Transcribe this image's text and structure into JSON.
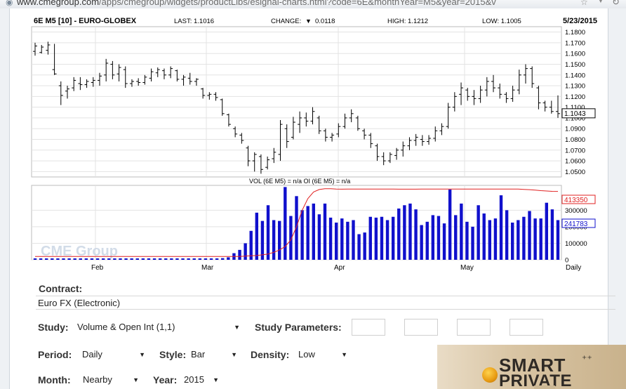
{
  "browser": {
    "url_domain": "www.cmegroup.com",
    "url_path": "/apps/cmegroup/widgets/productLibs/esignal-charts.html?code=6E&monthYear=M5&year=2015&v"
  },
  "chart": {
    "symbol_title": "6E M5 [10] - EURO-GLOBEX",
    "last": "LAST: 1.1016",
    "change_label": "CHANGE:",
    "change_arrow": "▼",
    "change_value": "0.0118",
    "high": "HIGH: 1.1212",
    "low": "LOW: 1.1005",
    "date": "5/23/2015",
    "price_axis": [
      "1.1800",
      "1.1700",
      "1.1600",
      "1.1500",
      "1.1400",
      "1.1300",
      "1.1200",
      "1.1100",
      "1.1000",
      "1.0900",
      "1.0800",
      "1.0700",
      "1.0600",
      "1.0500"
    ],
    "price_axis_values": [
      1.18,
      1.17,
      1.16,
      1.15,
      1.14,
      1.13,
      1.12,
      1.11,
      1.1,
      1.09,
      1.08,
      1.07,
      1.06,
      1.05
    ],
    "price_readout": "1.1043",
    "price_readout_value": 1.1043,
    "volume_title": "VOL (6E M5) = n/a OI (6E M5) = n/a",
    "volume_axis": [
      "300000",
      "200000",
      "100000",
      "0"
    ],
    "volume_axis_values": [
      300000,
      200000,
      100000,
      0
    ],
    "oi_readout": "413350",
    "oi_readout_value": 413350,
    "vol_readout": "241783",
    "vol_readout_value": 241783,
    "x_labels": [
      "Feb",
      "Mar",
      "Apr",
      "May",
      "Daily"
    ],
    "watermark": "CME Group",
    "colors": {
      "bars": "#1010cc",
      "oi_line": "#e02020",
      "oi_box": "#e02020",
      "vol_box": "#1010cc",
      "price": "#000000"
    }
  },
  "chart_data": {
    "type": "bar",
    "title": "6E M5 [10] - EURO-GLOBEX",
    "price_range": [
      1.045,
      1.185
    ],
    "volume_range": [
      0,
      450000
    ],
    "price_ohlc_bars": [
      {
        "h": 1.17,
        "l": 1.158,
        "o": 1.162,
        "c": 1.167
      },
      {
        "h": 1.168,
        "l": 1.16,
        "o": 1.161,
        "c": 1.166
      },
      {
        "h": 1.171,
        "l": 1.159,
        "o": 1.163,
        "c": 1.168
      },
      {
        "h": 1.169,
        "l": 1.14,
        "o": 1.145,
        "c": 1.141
      },
      {
        "h": 1.134,
        "l": 1.112,
        "o": 1.13,
        "c": 1.121
      },
      {
        "h": 1.13,
        "l": 1.118,
        "o": 1.125,
        "c": 1.127
      },
      {
        "h": 1.138,
        "l": 1.125,
        "o": 1.128,
        "c": 1.135
      },
      {
        "h": 1.138,
        "l": 1.126,
        "o": 1.132,
        "c": 1.131
      },
      {
        "h": 1.136,
        "l": 1.128,
        "o": 1.131,
        "c": 1.134
      },
      {
        "h": 1.138,
        "l": 1.129,
        "o": 1.133,
        "c": 1.135
      },
      {
        "h": 1.142,
        "l": 1.13,
        "o": 1.135,
        "c": 1.139
      },
      {
        "h": 1.155,
        "l": 1.134,
        "o": 1.14,
        "c": 1.151
      },
      {
        "h": 1.153,
        "l": 1.136,
        "o": 1.15,
        "c": 1.14
      },
      {
        "h": 1.15,
        "l": 1.134,
        "o": 1.141,
        "c": 1.147
      },
      {
        "h": 1.148,
        "l": 1.128,
        "o": 1.145,
        "c": 1.132
      },
      {
        "h": 1.136,
        "l": 1.129,
        "o": 1.132,
        "c": 1.134
      },
      {
        "h": 1.137,
        "l": 1.13,
        "o": 1.134,
        "c": 1.133
      },
      {
        "h": 1.14,
        "l": 1.131,
        "o": 1.133,
        "c": 1.138
      },
      {
        "h": 1.146,
        "l": 1.134,
        "o": 1.137,
        "c": 1.143
      },
      {
        "h": 1.147,
        "l": 1.138,
        "o": 1.142,
        "c": 1.145
      },
      {
        "h": 1.146,
        "l": 1.136,
        "o": 1.144,
        "c": 1.14
      },
      {
        "h": 1.148,
        "l": 1.137,
        "o": 1.14,
        "c": 1.146
      },
      {
        "h": 1.145,
        "l": 1.134,
        "o": 1.144,
        "c": 1.136
      },
      {
        "h": 1.14,
        "l": 1.13,
        "o": 1.136,
        "c": 1.138
      },
      {
        "h": 1.142,
        "l": 1.131,
        "o": 1.137,
        "c": 1.134
      },
      {
        "h": 1.137,
        "l": 1.13,
        "o": 1.134,
        "c": 1.136
      },
      {
        "h": 1.128,
        "l": 1.118,
        "o": 1.127,
        "c": 1.121
      },
      {
        "h": 1.124,
        "l": 1.117,
        "o": 1.121,
        "c": 1.122
      },
      {
        "h": 1.124,
        "l": 1.116,
        "o": 1.122,
        "c": 1.119
      },
      {
        "h": 1.118,
        "l": 1.102,
        "o": 1.117,
        "c": 1.104
      },
      {
        "h": 1.104,
        "l": 1.092,
        "o": 1.103,
        "c": 1.094
      },
      {
        "h": 1.092,
        "l": 1.082,
        "o": 1.09,
        "c": 1.085
      },
      {
        "h": 1.086,
        "l": 1.076,
        "o": 1.084,
        "c": 1.079
      },
      {
        "h": 1.074,
        "l": 1.055,
        "o": 1.072,
        "c": 1.06
      },
      {
        "h": 1.068,
        "l": 1.05,
        "o": 1.06,
        "c": 1.066
      },
      {
        "h": 1.066,
        "l": 1.048,
        "o": 1.064,
        "c": 1.052
      },
      {
        "h": 1.064,
        "l": 1.052,
        "o": 1.054,
        "c": 1.061
      },
      {
        "h": 1.072,
        "l": 1.058,
        "o": 1.062,
        "c": 1.068
      },
      {
        "h": 1.098,
        "l": 1.06,
        "o": 1.066,
        "c": 1.094
      },
      {
        "h": 1.094,
        "l": 1.072,
        "o": 1.09,
        "c": 1.078
      },
      {
        "h": 1.101,
        "l": 1.08,
        "o": 1.082,
        "c": 1.096
      },
      {
        "h": 1.106,
        "l": 1.086,
        "o": 1.094,
        "c": 1.1
      },
      {
        "h": 1.105,
        "l": 1.092,
        "o": 1.1,
        "c": 1.097
      },
      {
        "h": 1.11,
        "l": 1.094,
        "o": 1.097,
        "c": 1.106
      },
      {
        "h": 1.102,
        "l": 1.085,
        "o": 1.1,
        "c": 1.088
      },
      {
        "h": 1.09,
        "l": 1.078,
        "o": 1.088,
        "c": 1.082
      },
      {
        "h": 1.086,
        "l": 1.078,
        "o": 1.082,
        "c": 1.084
      },
      {
        "h": 1.095,
        "l": 1.082,
        "o": 1.085,
        "c": 1.092
      },
      {
        "h": 1.104,
        "l": 1.09,
        "o": 1.092,
        "c": 1.1
      },
      {
        "h": 1.108,
        "l": 1.096,
        "o": 1.1,
        "c": 1.104
      },
      {
        "h": 1.102,
        "l": 1.088,
        "o": 1.1,
        "c": 1.09
      },
      {
        "h": 1.09,
        "l": 1.08,
        "o": 1.088,
        "c": 1.084
      },
      {
        "h": 1.086,
        "l": 1.072,
        "o": 1.084,
        "c": 1.076
      },
      {
        "h": 1.076,
        "l": 1.06,
        "o": 1.074,
        "c": 1.064
      },
      {
        "h": 1.068,
        "l": 1.056,
        "o": 1.064,
        "c": 1.06
      },
      {
        "h": 1.068,
        "l": 1.058,
        "o": 1.06,
        "c": 1.066
      },
      {
        "h": 1.072,
        "l": 1.061,
        "o": 1.065,
        "c": 1.07
      },
      {
        "h": 1.078,
        "l": 1.064,
        "o": 1.07,
        "c": 1.074
      },
      {
        "h": 1.082,
        "l": 1.07,
        "o": 1.074,
        "c": 1.079
      },
      {
        "h": 1.085,
        "l": 1.074,
        "o": 1.079,
        "c": 1.082
      },
      {
        "h": 1.084,
        "l": 1.074,
        "o": 1.08,
        "c": 1.078
      },
      {
        "h": 1.084,
        "l": 1.075,
        "o": 1.078,
        "c": 1.081
      },
      {
        "h": 1.092,
        "l": 1.078,
        "o": 1.081,
        "c": 1.088
      },
      {
        "h": 1.095,
        "l": 1.084,
        "o": 1.088,
        "c": 1.092
      },
      {
        "h": 1.114,
        "l": 1.09,
        "o": 1.092,
        "c": 1.11
      },
      {
        "h": 1.124,
        "l": 1.106,
        "o": 1.11,
        "c": 1.12
      },
      {
        "h": 1.133,
        "l": 1.112,
        "o": 1.122,
        "c": 1.128
      },
      {
        "h": 1.128,
        "l": 1.116,
        "o": 1.126,
        "c": 1.12
      },
      {
        "h": 1.126,
        "l": 1.112,
        "o": 1.12,
        "c": 1.118
      },
      {
        "h": 1.13,
        "l": 1.114,
        "o": 1.118,
        "c": 1.126
      },
      {
        "h": 1.138,
        "l": 1.12,
        "o": 1.126,
        "c": 1.134
      },
      {
        "h": 1.14,
        "l": 1.124,
        "o": 1.134,
        "c": 1.128
      },
      {
        "h": 1.132,
        "l": 1.118,
        "o": 1.128,
        "c": 1.122
      },
      {
        "h": 1.124,
        "l": 1.114,
        "o": 1.122,
        "c": 1.118
      },
      {
        "h": 1.13,
        "l": 1.115,
        "o": 1.118,
        "c": 1.126
      },
      {
        "h": 1.145,
        "l": 1.122,
        "o": 1.126,
        "c": 1.14
      },
      {
        "h": 1.15,
        "l": 1.132,
        "o": 1.14,
        "c": 1.146
      },
      {
        "h": 1.148,
        "l": 1.128,
        "o": 1.146,
        "c": 1.132
      },
      {
        "h": 1.13,
        "l": 1.108,
        "o": 1.128,
        "c": 1.114
      },
      {
        "h": 1.116,
        "l": 1.106,
        "o": 1.114,
        "c": 1.11
      },
      {
        "h": 1.116,
        "l": 1.104,
        "o": 1.11,
        "c": 1.106
      },
      {
        "h": 1.121,
        "l": 1.1,
        "o": 1.106,
        "c": 1.104
      }
    ],
    "volume_bars": [
      {
        "month_index": 0,
        "values": [
          5000,
          5000,
          5000,
          5000,
          5000,
          5000,
          5000,
          5000,
          5000,
          5000,
          5000,
          5000,
          5000,
          5000,
          5000,
          5000,
          5000,
          5000,
          5000,
          5000
        ]
      },
      {
        "month_index": 1,
        "values": [
          5000,
          5000,
          5000,
          5000,
          5000,
          6000,
          6000,
          6000,
          6000,
          6000,
          7000,
          7000,
          8000,
          10000,
          15000,
          40000,
          60000,
          100000,
          175000,
          280000
        ]
      }
    ],
    "volume_values": [
      5000,
      5000,
      5000,
      5000,
      5000,
      5000,
      5000,
      5000,
      5000,
      5000,
      5000,
      5000,
      5000,
      5000,
      5000,
      5000,
      5000,
      5000,
      5000,
      5000,
      5000,
      5000,
      5000,
      5000,
      5000,
      6000,
      6000,
      6000,
      6000,
      6000,
      7000,
      7000,
      8000,
      10000,
      15000,
      40000,
      60000,
      100000,
      175000,
      285000,
      235000,
      330000,
      240000,
      235000,
      440000,
      265000,
      385000,
      300000,
      325000,
      340000,
      275000,
      340000,
      255000,
      225000,
      250000,
      230000,
      240000,
      155000,
      165000,
      260000,
      255000,
      260000,
      240000,
      260000,
      310000,
      330000,
      340000,
      305000,
      210000,
      230000,
      270000,
      265000,
      220000,
      425000,
      270000,
      340000,
      230000,
      200000,
      330000,
      280000,
      240000,
      250000,
      390000,
      300000,
      225000,
      240000,
      260000,
      295000,
      250000,
      250000,
      345000,
      305000,
      240000
    ],
    "oi_values": [
      20000,
      20000,
      20000,
      20000,
      20000,
      20000,
      20000,
      20000,
      20000,
      20000,
      20000,
      20000,
      20000,
      20000,
      20000,
      20000,
      20000,
      20000,
      20000,
      20000,
      20000,
      20000,
      20000,
      20000,
      20000,
      20000,
      20000,
      20000,
      20000,
      20000,
      20000,
      20000,
      20000,
      20000,
      20000,
      20000,
      20000,
      22000,
      24000,
      26000,
      30000,
      35000,
      45000,
      60000,
      80000,
      120000,
      200000,
      300000,
      370000,
      410000,
      425000,
      430000,
      430000,
      428000,
      427000,
      428000,
      428000,
      428000,
      428000,
      428000,
      428000,
      428000,
      428000,
      428000,
      427000,
      427000,
      427000,
      427000,
      428000,
      428000,
      428000,
      428000,
      428000,
      428000,
      428000,
      428000,
      428000,
      428000,
      428000,
      428000,
      428000,
      428000,
      428000,
      428000,
      428000,
      428000,
      426000,
      424000,
      421000,
      418000,
      416000,
      414000,
      413350
    ]
  },
  "form": {
    "contract_label": "Contract:",
    "contract_value": "Euro FX (Electronic)",
    "study_label": "Study:",
    "study_value": "Volume & Open Int (1,1)",
    "study_params_label": "Study Parameters:",
    "period_label": "Period:",
    "period_value": "Daily",
    "style_label": "Style:",
    "style_value": "Bar",
    "density_label": "Density:",
    "density_value": "Low",
    "month_label": "Month:",
    "month_value": "Nearby",
    "year_label": "Year:",
    "year_value": "2015"
  },
  "banner": {
    "line1": "SMART",
    "line2": "PRIVATE"
  }
}
